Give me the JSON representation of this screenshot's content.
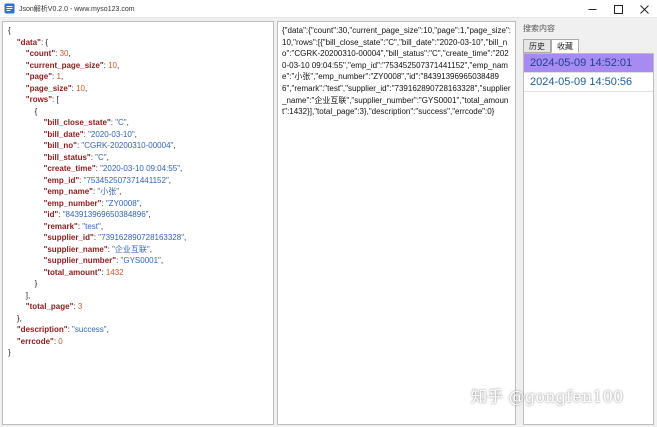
{
  "window": {
    "title": "Json解析V0.2.0 - www.myso123.com"
  },
  "tree": [
    {
      "i": 0,
      "p": "{"
    },
    {
      "i": 1,
      "k": "\"data\"",
      "p": ": {"
    },
    {
      "i": 2,
      "k": "\"count\"",
      "p": ": ",
      "v": "30",
      "t": "n",
      "c": ","
    },
    {
      "i": 2,
      "k": "\"current_page_size\"",
      "p": ": ",
      "v": "10",
      "t": "n",
      "c": ","
    },
    {
      "i": 2,
      "k": "\"page\"",
      "p": ": ",
      "v": "1",
      "t": "n",
      "c": ","
    },
    {
      "i": 2,
      "k": "\"page_size\"",
      "p": ": ",
      "v": "10",
      "t": "n",
      "c": ","
    },
    {
      "i": 2,
      "k": "\"rows\"",
      "p": ": ["
    },
    {
      "i": 3,
      "p": "{"
    },
    {
      "i": 4,
      "k": "\"bill_close_state\"",
      "p": ": ",
      "v": "\"C\"",
      "t": "s",
      "c": ","
    },
    {
      "i": 4,
      "k": "\"bill_date\"",
      "p": ": ",
      "v": "\"2020-03-10\"",
      "t": "s",
      "c": ","
    },
    {
      "i": 4,
      "k": "\"bill_no\"",
      "p": ": ",
      "v": "\"CGRK-20200310-00004\"",
      "t": "s",
      "c": ","
    },
    {
      "i": 4,
      "k": "\"bill_status\"",
      "p": ": ",
      "v": "\"C\"",
      "t": "s",
      "c": ","
    },
    {
      "i": 4,
      "k": "\"create_time\"",
      "p": ": ",
      "v": "\"2020-03-10 09:04:55\"",
      "t": "s",
      "c": ","
    },
    {
      "i": 4,
      "k": "\"emp_id\"",
      "p": ": ",
      "v": "\"753452507371441152\"",
      "t": "s",
      "c": ","
    },
    {
      "i": 4,
      "k": "\"emp_name\"",
      "p": ": ",
      "v": "\"小张\"",
      "t": "s",
      "c": ","
    },
    {
      "i": 4,
      "k": "\"emp_number\"",
      "p": ": ",
      "v": "\"ZY0008\"",
      "t": "s",
      "c": ","
    },
    {
      "i": 4,
      "k": "\"id\"",
      "p": ": ",
      "v": "\"843913969650384896\"",
      "t": "s",
      "c": ","
    },
    {
      "i": 4,
      "k": "\"remark\"",
      "p": ": ",
      "v": "\"test\"",
      "t": "s",
      "c": ","
    },
    {
      "i": 4,
      "k": "\"supplier_id\"",
      "p": ": ",
      "v": "\"739162890728163328\"",
      "t": "s",
      "c": ","
    },
    {
      "i": 4,
      "k": "\"supplier_name\"",
      "p": ": ",
      "v": "\"企业互联\"",
      "t": "s",
      "c": ","
    },
    {
      "i": 4,
      "k": "\"supplier_number\"",
      "p": ": ",
      "v": "\"GYS0001\"",
      "t": "s",
      "c": ","
    },
    {
      "i": 4,
      "k": "\"total_amount\"",
      "p": ": ",
      "v": "1432",
      "t": "n"
    },
    {
      "i": 3,
      "p": "}"
    },
    {
      "i": 2,
      "p": "],"
    },
    {
      "i": 2,
      "k": "\"total_page\"",
      "p": ": ",
      "v": "3",
      "t": "n"
    },
    {
      "i": 1,
      "p": "},"
    },
    {
      "i": 1,
      "k": "\"description\"",
      "p": ": ",
      "v": "\"success\"",
      "t": "s",
      "c": ","
    },
    {
      "i": 1,
      "k": "\"errcode\"",
      "p": ": ",
      "v": "0",
      "t": "n"
    },
    {
      "i": 0,
      "p": "}"
    }
  ],
  "raw_text": "{\"data\":{\"count\":30,\"current_page_size\":10,\"page\":1,\"page_size\":10,\"rows\":[{\"bill_close_state\":\"C\",\"bill_date\":\"2020-03-10\",\"bill_no\":\"CGRK-20200310-00004\",\"bill_status\":\"C\",\"create_time\":\"2020-03-10 09:04:55\",\"emp_id\":\"753452507371441152\",\"emp_name\":\"小张\",\"emp_number\":\"ZY0008\",\"id\":\"843913969650384896\",\"remark\":\"test\",\"supplier_id\":\"739162890728163328\",\"supplier_name\":\"企业互联\",\"supplier_number\":\"GYS0001\",\"total_amount\":1432}],\"total_page\":3},\"description\":\"success\",\"errcode\":0}",
  "history": {
    "search_label": "搜索内容",
    "tabs": [
      "历史",
      "收藏"
    ],
    "items": [
      "2024-05-09 14:52:01",
      "2024-05-09 14:50:56"
    ]
  },
  "watermark": "知乎 @gongfen100",
  "colors": {
    "key": "#8b1a1a",
    "string": "#3264b4",
    "number": "#d2582a",
    "selected_row": "#a78bf0"
  }
}
